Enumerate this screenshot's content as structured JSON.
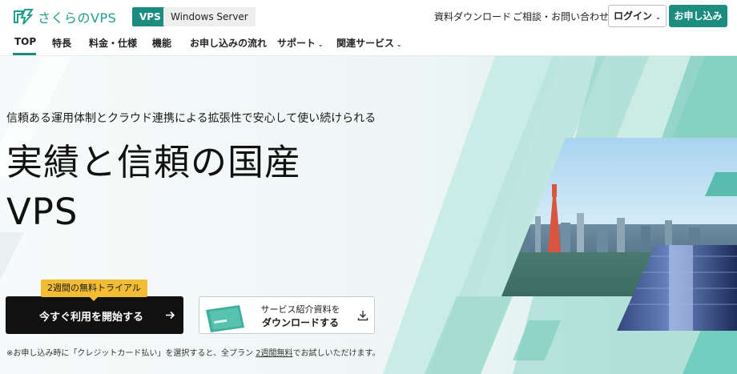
{
  "brand": {
    "logo_text": "さくらのVPS",
    "logo_icon": "sakura-logo-icon",
    "accent": "#1d8c80",
    "teal_light": "#58c6b4"
  },
  "header": {
    "tag_vps": "VPS",
    "tag_windows": "Windows Server",
    "link_download": "資料ダウンロード",
    "link_contact": "ご相談・お問い合わせ",
    "login_label": "ログイン",
    "apply_label": "お申し込み"
  },
  "nav": {
    "items": [
      {
        "label": "TOP",
        "active": true
      },
      {
        "label": "特長"
      },
      {
        "label": "料金・仕様"
      },
      {
        "label": "機能"
      },
      {
        "label": "お申し込みの流れ"
      },
      {
        "label": "サポート",
        "dropdown": true
      },
      {
        "label": "関連サービス",
        "dropdown": true
      }
    ]
  },
  "hero": {
    "sub_tagline": "信頼ある運用体制とクラウド連携による拡張性で安心して使い続けられる",
    "headline_line1": "実績と信頼の国産",
    "headline_line2": "VPS",
    "trial_badge": "2週間の無料トライアル",
    "start_button": "今すぐ利用を開始する",
    "download_line1": "サービス紹介資料を",
    "download_line2": "ダウンロードする",
    "note_prefix": "※お申し込み時に「クレジットカード払い」を選択すると、全プラン ",
    "note_link": "2週間無料",
    "note_suffix": "でお試しいただけます。"
  }
}
